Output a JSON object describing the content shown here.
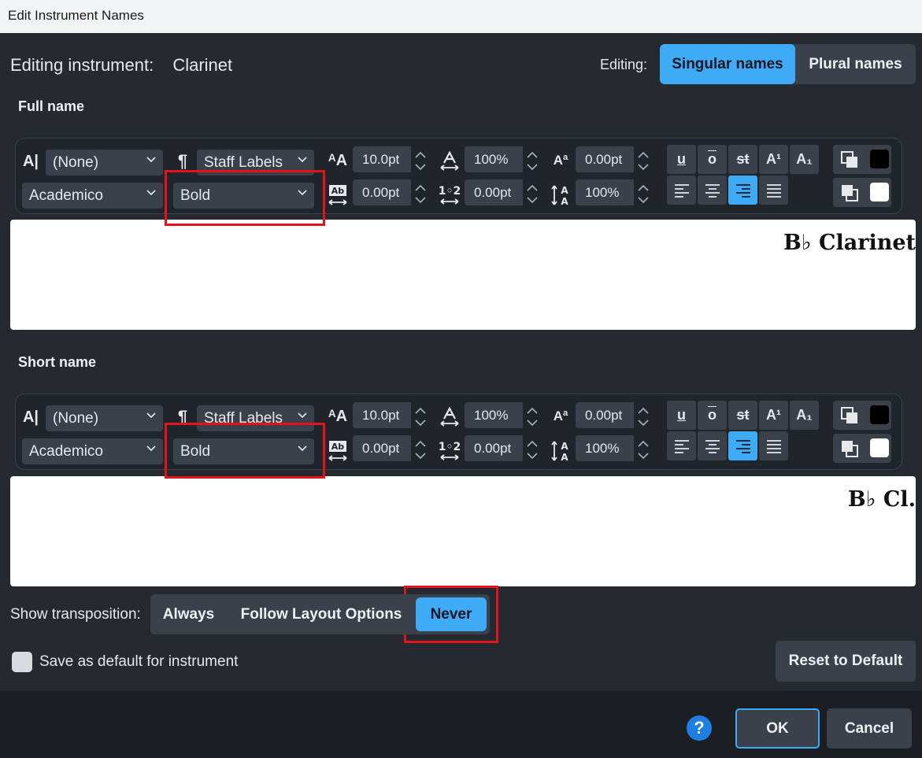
{
  "window": {
    "title": "Edit Instrument Names"
  },
  "header": {
    "editing_instrument_label": "Editing instrument:",
    "instrument_name": "Clarinet",
    "editing_label": "Editing:",
    "mode_options": [
      "Singular names",
      "Plural names"
    ],
    "mode_selected": "Singular names"
  },
  "full_name": {
    "title": "Full name",
    "char_style": "(None)",
    "para_style": "Staff Labels",
    "font_family": "Academico",
    "font_style": "Bold",
    "font_size": "10.0pt",
    "width_scale": "100%",
    "baseline_shift": "0.00pt",
    "letter_spacing": "0.00pt",
    "word_spacing": "0.00pt",
    "line_spacing": "100%",
    "format_buttons": [
      "u",
      "o",
      "st",
      "A¹",
      "A₁"
    ],
    "alignment_selected": "right",
    "text_color": "#000000",
    "background_color": "#ffffff",
    "preview_text": "B♭ Clarinet"
  },
  "short_name": {
    "title": "Short name",
    "char_style": "(None)",
    "para_style": "Staff Labels",
    "font_family": "Academico",
    "font_style": "Bold",
    "font_size": "10.0pt",
    "width_scale": "100%",
    "baseline_shift": "0.00pt",
    "letter_spacing": "0.00pt",
    "word_spacing": "0.00pt",
    "line_spacing": "100%",
    "format_buttons": [
      "u",
      "o",
      "st",
      "A¹",
      "A₁"
    ],
    "alignment_selected": "right",
    "text_color": "#000000",
    "background_color": "#ffffff",
    "preview_text": "B♭ Cl."
  },
  "transposition": {
    "label": "Show transposition:",
    "options": [
      "Always",
      "Follow Layout Options",
      "Never"
    ],
    "selected": "Never"
  },
  "save_default": {
    "label": "Save as default for instrument",
    "checked": false
  },
  "buttons": {
    "reset": "Reset to Default",
    "ok": "OK",
    "cancel": "Cancel",
    "help": "?"
  },
  "colors": {
    "accent": "#3faaf6",
    "highlight_box": "#e2131a",
    "help": "#1f7fe0"
  }
}
